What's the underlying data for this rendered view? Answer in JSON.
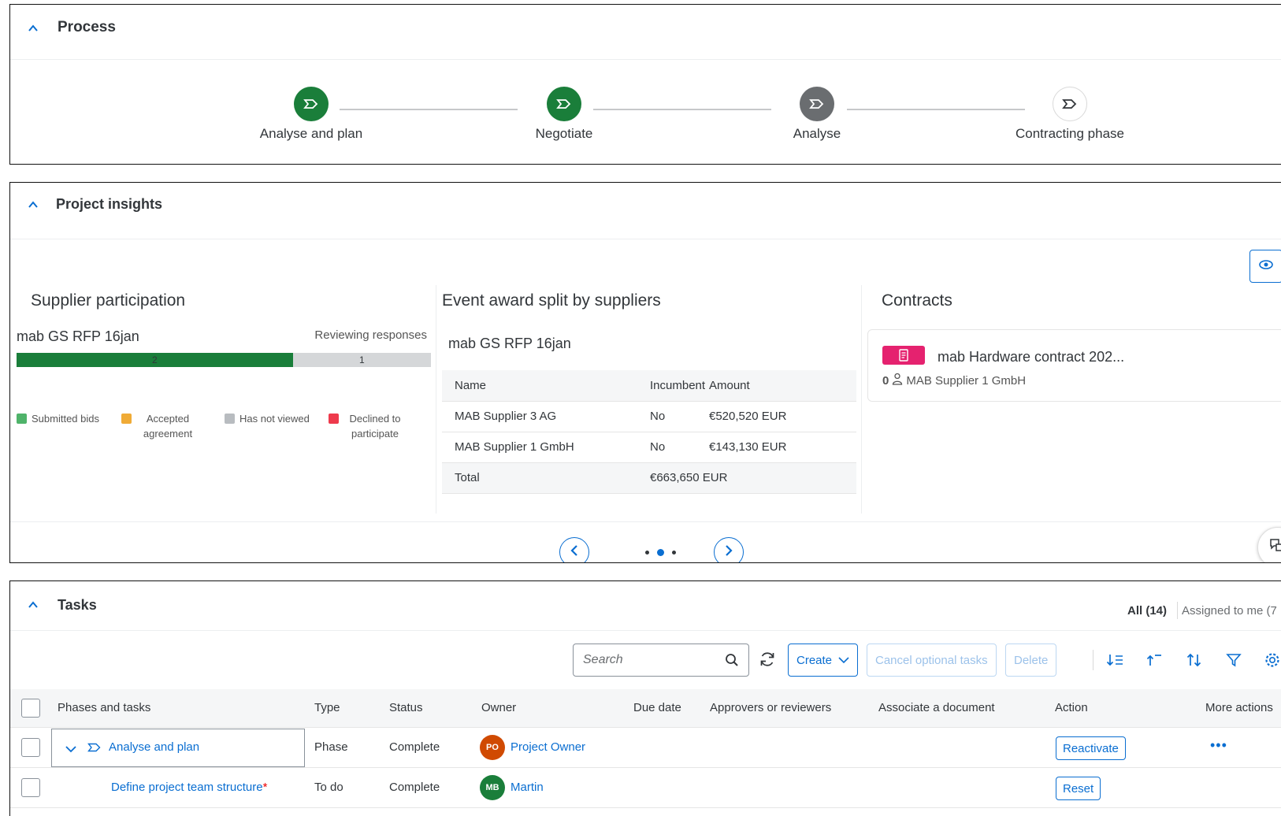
{
  "process": {
    "title": "Process",
    "steps": [
      {
        "label": "Analyse and plan",
        "state": "complete"
      },
      {
        "label": "Negotiate",
        "state": "complete"
      },
      {
        "label": "Analyse",
        "state": "current"
      },
      {
        "label": "Contracting phase",
        "state": "pending"
      }
    ]
  },
  "insights": {
    "title": "Project insights",
    "supplier_participation": {
      "title": "Supplier participation",
      "event_name": "mab GS RFP 16jan",
      "event_status": "Reviewing responses",
      "bar": [
        {
          "label": "2",
          "value": 2,
          "color": "#1a7e3a"
        },
        {
          "label": "1",
          "value": 1,
          "color": "#d5d7d9"
        }
      ],
      "legend": [
        {
          "label": "Submitted bids",
          "color": "#4fb36a"
        },
        {
          "label": "Accepted agreement",
          "color": "#f0ab36"
        },
        {
          "label": "Has not viewed",
          "color": "#b8bcc0"
        },
        {
          "label": "Declined to participate",
          "color": "#ee3a4c"
        }
      ]
    },
    "event_award": {
      "title": "Event award split by suppliers",
      "event_name": "mab GS RFP 16jan",
      "headers": [
        "Name",
        "Incumbent",
        "Amount"
      ],
      "rows": [
        {
          "name": "MAB Supplier 3 AG",
          "incumbent": "No",
          "amount": "€520,520 EUR"
        },
        {
          "name": "MAB Supplier 1 GmbH",
          "incumbent": "No",
          "amount": "€143,130 EUR"
        }
      ],
      "total_label": "Total",
      "total_amount": "€663,650 EUR"
    },
    "contracts": {
      "title": "Contracts",
      "card_title": "mab Hardware contract 202...",
      "card_count": "0",
      "card_supplier": "MAB Supplier 1 GmbH",
      "badge_color": "#e5226f"
    },
    "carousel": {
      "pages": 3,
      "active": 1
    }
  },
  "tasks": {
    "title": "Tasks",
    "tab_all": "All (14)",
    "tab_me": "Assigned to me (7",
    "search_placeholder": "Search",
    "create_label": "Create",
    "cancel_optional_label": "Cancel optional tasks",
    "delete_label": "Delete",
    "columns": [
      "Phases and tasks",
      "Type",
      "Status",
      "Owner",
      "Due date",
      "Approvers or reviewers",
      "Associate a document",
      "Action",
      "More actions"
    ],
    "rows": [
      {
        "name": "Analyse and plan",
        "type": "Phase",
        "status": "Complete",
        "owner_initials": "PO",
        "owner": "Project Owner",
        "owner_color": "#d04a02",
        "action": "Reactivate",
        "more": "•••",
        "required": ""
      },
      {
        "name": "Define project team structure",
        "type": "To do",
        "status": "Complete",
        "owner_initials": "MB",
        "owner": "Martin",
        "owner_color": "#1a7e3a",
        "action": "Reset",
        "more": "",
        "required": "*"
      }
    ]
  },
  "colors": {
    "accent": "#0a6ed1",
    "complete": "#1a7e3a",
    "current": "#6a6d70"
  }
}
